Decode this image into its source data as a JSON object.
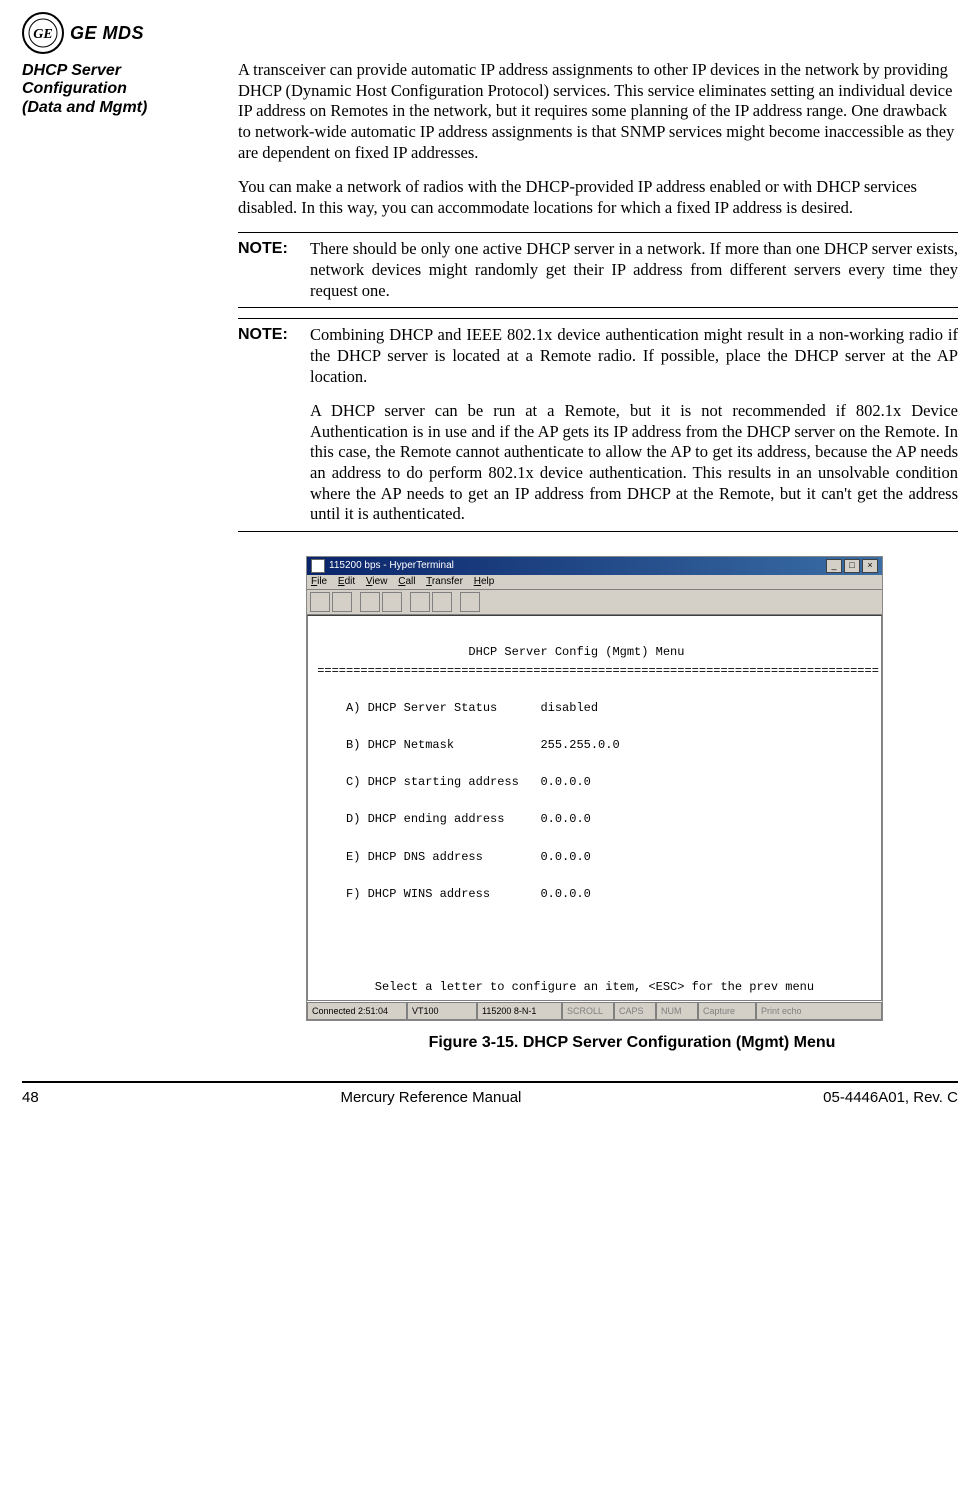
{
  "brand": {
    "name": "GE MDS"
  },
  "sidebar": {
    "heading_line1": "DHCP Server",
    "heading_line2": "Configuration",
    "heading_line3": "(Data and Mgmt)"
  },
  "body": {
    "p1": "A transceiver can provide automatic IP address assignments to other IP devices in the network by providing DHCP (Dynamic Host Configuration Protocol) services. This service eliminates setting an individual device IP address on Remotes in the network, but it requires some planning of the IP address range. One drawback to network-wide automatic IP address assignments is that SNMP services might become inaccessible as they are dependent on fixed IP addresses.",
    "p2": "You can make a network of radios with the DHCP-provided IP address enabled or with DHCP services disabled. In this way, you can accommodate locations for which a fixed IP address is desired.",
    "note1_label": "NOTE:",
    "note1_text": "There should be only one active DHCP server in a network. If more than one DHCP server exists, network devices might randomly get their IP address from different servers every time they request one.",
    "note2_label": "NOTE:",
    "note2_text1": "Combining DHCP and IEEE 802.1x device authentication might result in a non-working radio if the DHCP server is located at a Remote radio. If possible, place the DHCP server at the AP location.",
    "note2_text2": "A DHCP server can be run at a Remote, but it is not recommended if 802.1x Device Authentication is in use and if the AP gets its IP address from the DHCP server on the Remote. In this case, the Remote cannot authenticate to allow the AP to get its address, because the AP needs an address to do perform 802.1x device authentication. This results in an unsolvable condition where the AP needs to get an IP address from DHCP at the Remote, but it can't get the address until it is authenticated."
  },
  "terminal": {
    "window_title": "115200 bps - HyperTerminal",
    "menu": {
      "file": "File",
      "edit": "Edit",
      "view": "View",
      "call": "Call",
      "transfer": "Transfer",
      "help": "Help"
    },
    "screen_title": "DHCP Server Config (Mgmt) Menu",
    "rows": [
      {
        "key": "A) DHCP Server Status",
        "value": "disabled"
      },
      {
        "key": "B) DHCP Netmask",
        "value": "255.255.0.0"
      },
      {
        "key": "C) DHCP starting address",
        "value": "0.0.0.0"
      },
      {
        "key": "D) DHCP ending address",
        "value": "0.0.0.0"
      },
      {
        "key": "E) DHCP DNS address",
        "value": "0.0.0.0"
      },
      {
        "key": "F) DHCP WINS address",
        "value": "0.0.0.0"
      }
    ],
    "prompt": "Select a letter to configure an item, <ESC> for the prev menu",
    "status": {
      "connected": "Connected 2:51:04",
      "emulation": "VT100",
      "port": "115200 8-N-1",
      "scroll": "SCROLL",
      "caps": "CAPS",
      "num": "NUM",
      "capture": "Capture",
      "printecho": "Print echo"
    }
  },
  "figure_caption": "Figure 3-15. DHCP Server Configuration (Mgmt) Menu",
  "footer": {
    "page": "48",
    "center": "Mercury Reference Manual",
    "right": "05-4446A01, Rev. C"
  }
}
